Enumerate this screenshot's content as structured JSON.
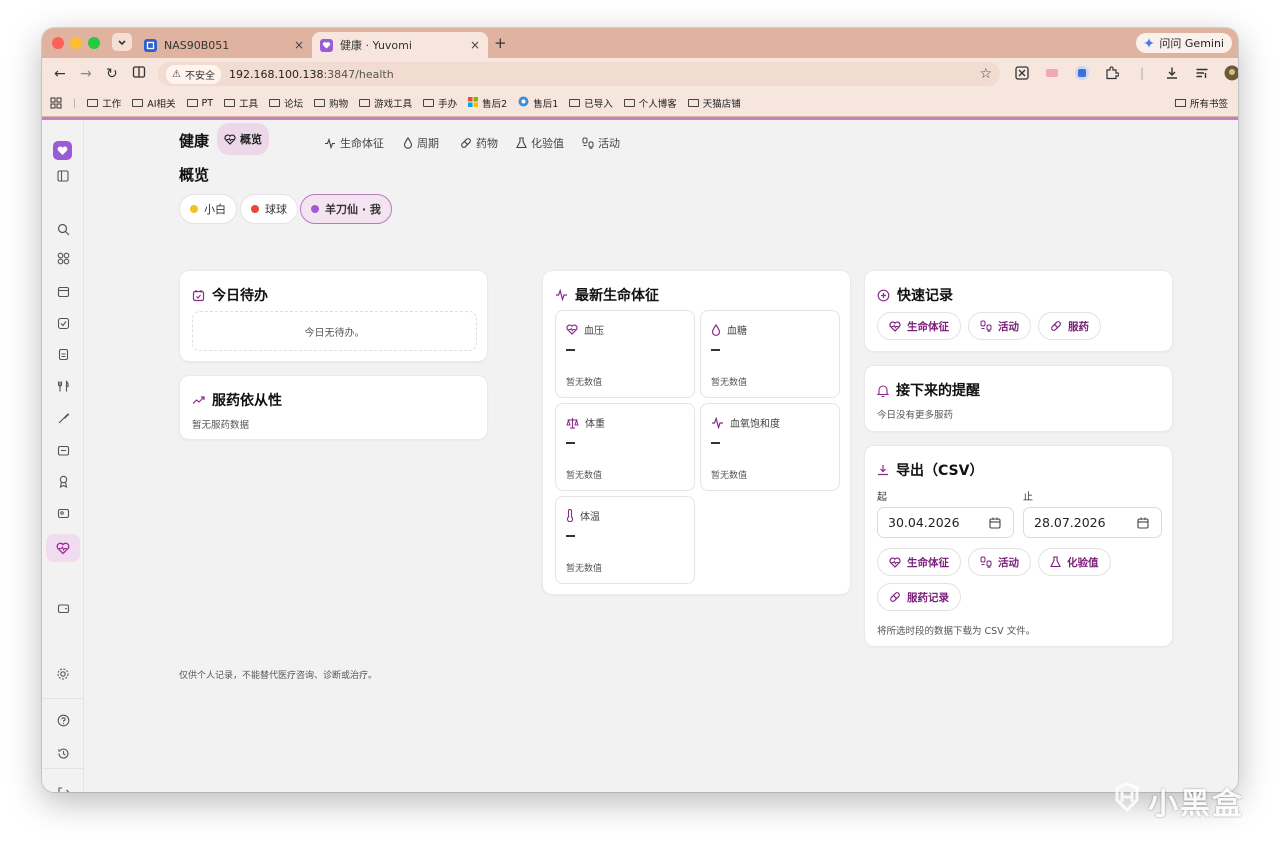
{
  "browser": {
    "tabs": [
      {
        "title": "NAS90B051",
        "close": "×"
      },
      {
        "title": "健康 · Yuvomi",
        "close": "×"
      }
    ],
    "new_tab": "+",
    "gemini_label": "问问 Gemini",
    "insecure_label": "不安全",
    "url_host": "192.168.100.138",
    "url_path": ":3847/health",
    "bookmarks": [
      "工作",
      "AI相关",
      "PT",
      "工具",
      "论坛",
      "购物",
      "游戏工具",
      "手办",
      "售后2",
      "售后1",
      "已导入",
      "个人博客",
      "天猫店铺"
    ],
    "bookmarks_right": "所有书签"
  },
  "app": {
    "nav_title": "健康",
    "nav_tabs": [
      "概览",
      "生命体征",
      "周期",
      "药物",
      "化验值",
      "活动"
    ],
    "page_title": "概览",
    "persons": [
      {
        "name": "小白",
        "color": "#f2c11e"
      },
      {
        "name": "球球",
        "color": "#e64a3b"
      },
      {
        "name": "羊刀仙 · 我",
        "color": "#a259d9"
      }
    ],
    "todo": {
      "title": "今日待办",
      "empty": "今日无待办。"
    },
    "adherence": {
      "title": "服药依从性",
      "empty": "暂无服药数据"
    },
    "vitals": {
      "title": "最新生命体征",
      "items": [
        {
          "label": "血压",
          "value": "–",
          "status": "暂无数值"
        },
        {
          "label": "血糖",
          "value": "–",
          "status": "暂无数值"
        },
        {
          "label": "体重",
          "value": "–",
          "status": "暂无数值"
        },
        {
          "label": "血氧饱和度",
          "value": "–",
          "status": "暂无数值"
        },
        {
          "label": "体温",
          "value": "–",
          "status": "暂无数值"
        }
      ]
    },
    "quick": {
      "title": "快速记录",
      "buttons": [
        "生命体征",
        "活动",
        "服药"
      ]
    },
    "reminders": {
      "title": "接下来的提醒",
      "empty": "今日没有更多服药"
    },
    "export": {
      "title": "导出（CSV）",
      "from_label": "起",
      "to_label": "止",
      "from_value": "30.04.2026",
      "to_value": "28.07.2026",
      "buttons": [
        "生命体征",
        "活动",
        "化验值",
        "服药记录"
      ],
      "note": "将所选时段的数据下载为 CSV 文件。"
    },
    "footer": "仅供个人记录，不能替代医疗咨询、诊断或治疗。",
    "accent_color": "#8a2b8a"
  },
  "watermark": "小黑盒"
}
